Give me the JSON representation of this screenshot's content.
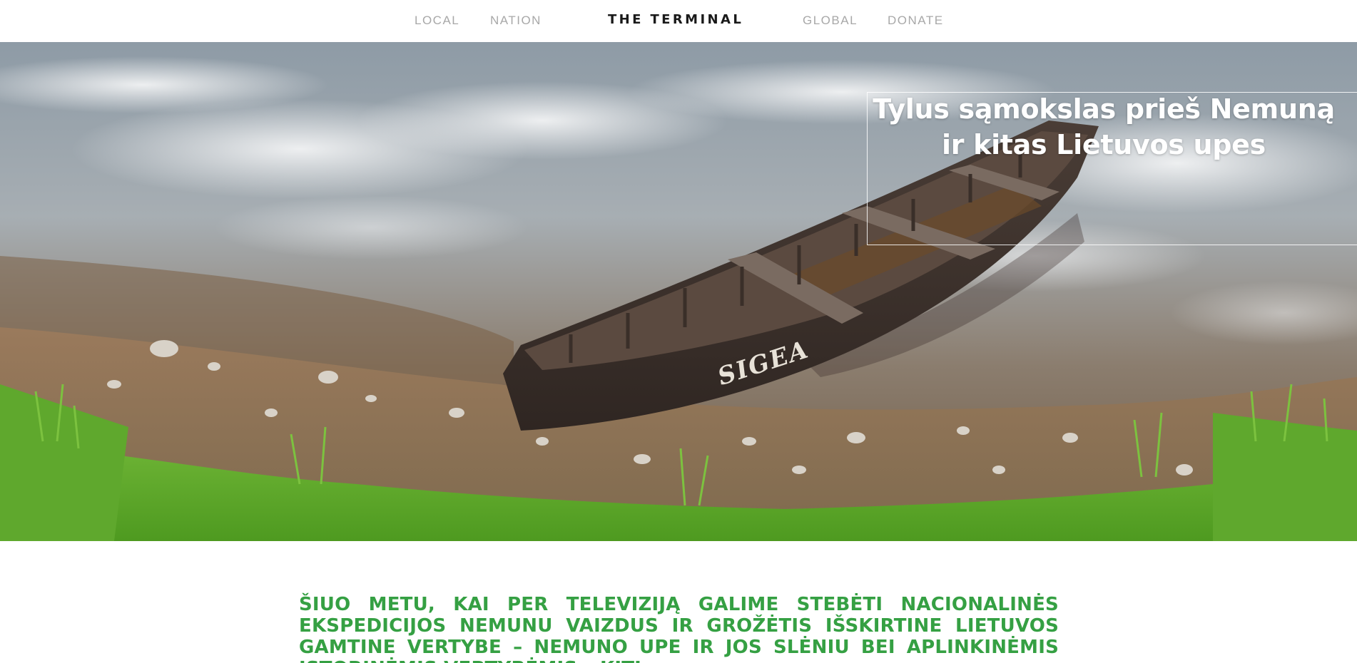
{
  "nav": {
    "local": "LOCAL",
    "nation": "NATION",
    "brand": "THE TERMINAL",
    "global": "GLOBAL",
    "donate": "DONATE"
  },
  "hero": {
    "headline": "Tylus sąmokslas prieš Nemuną ir kitas Lietuvos upes",
    "boat_name": "SIGEA"
  },
  "article": {
    "lead": "Šiuo metu, kai per televiziją galime stebėti nacionalinės ekspedicijos Nemunu vaizdus ir grožėtis išskirtine Lietuvos gamtine vertybe – Nemuno upe ir jos slėniu bei aplinkinėmis istorinėmis vertybėmis – kiti"
  },
  "colors": {
    "accent_green": "#35a043",
    "nav_text": "#a8a8a8",
    "brand_text": "#1a1a1a"
  }
}
